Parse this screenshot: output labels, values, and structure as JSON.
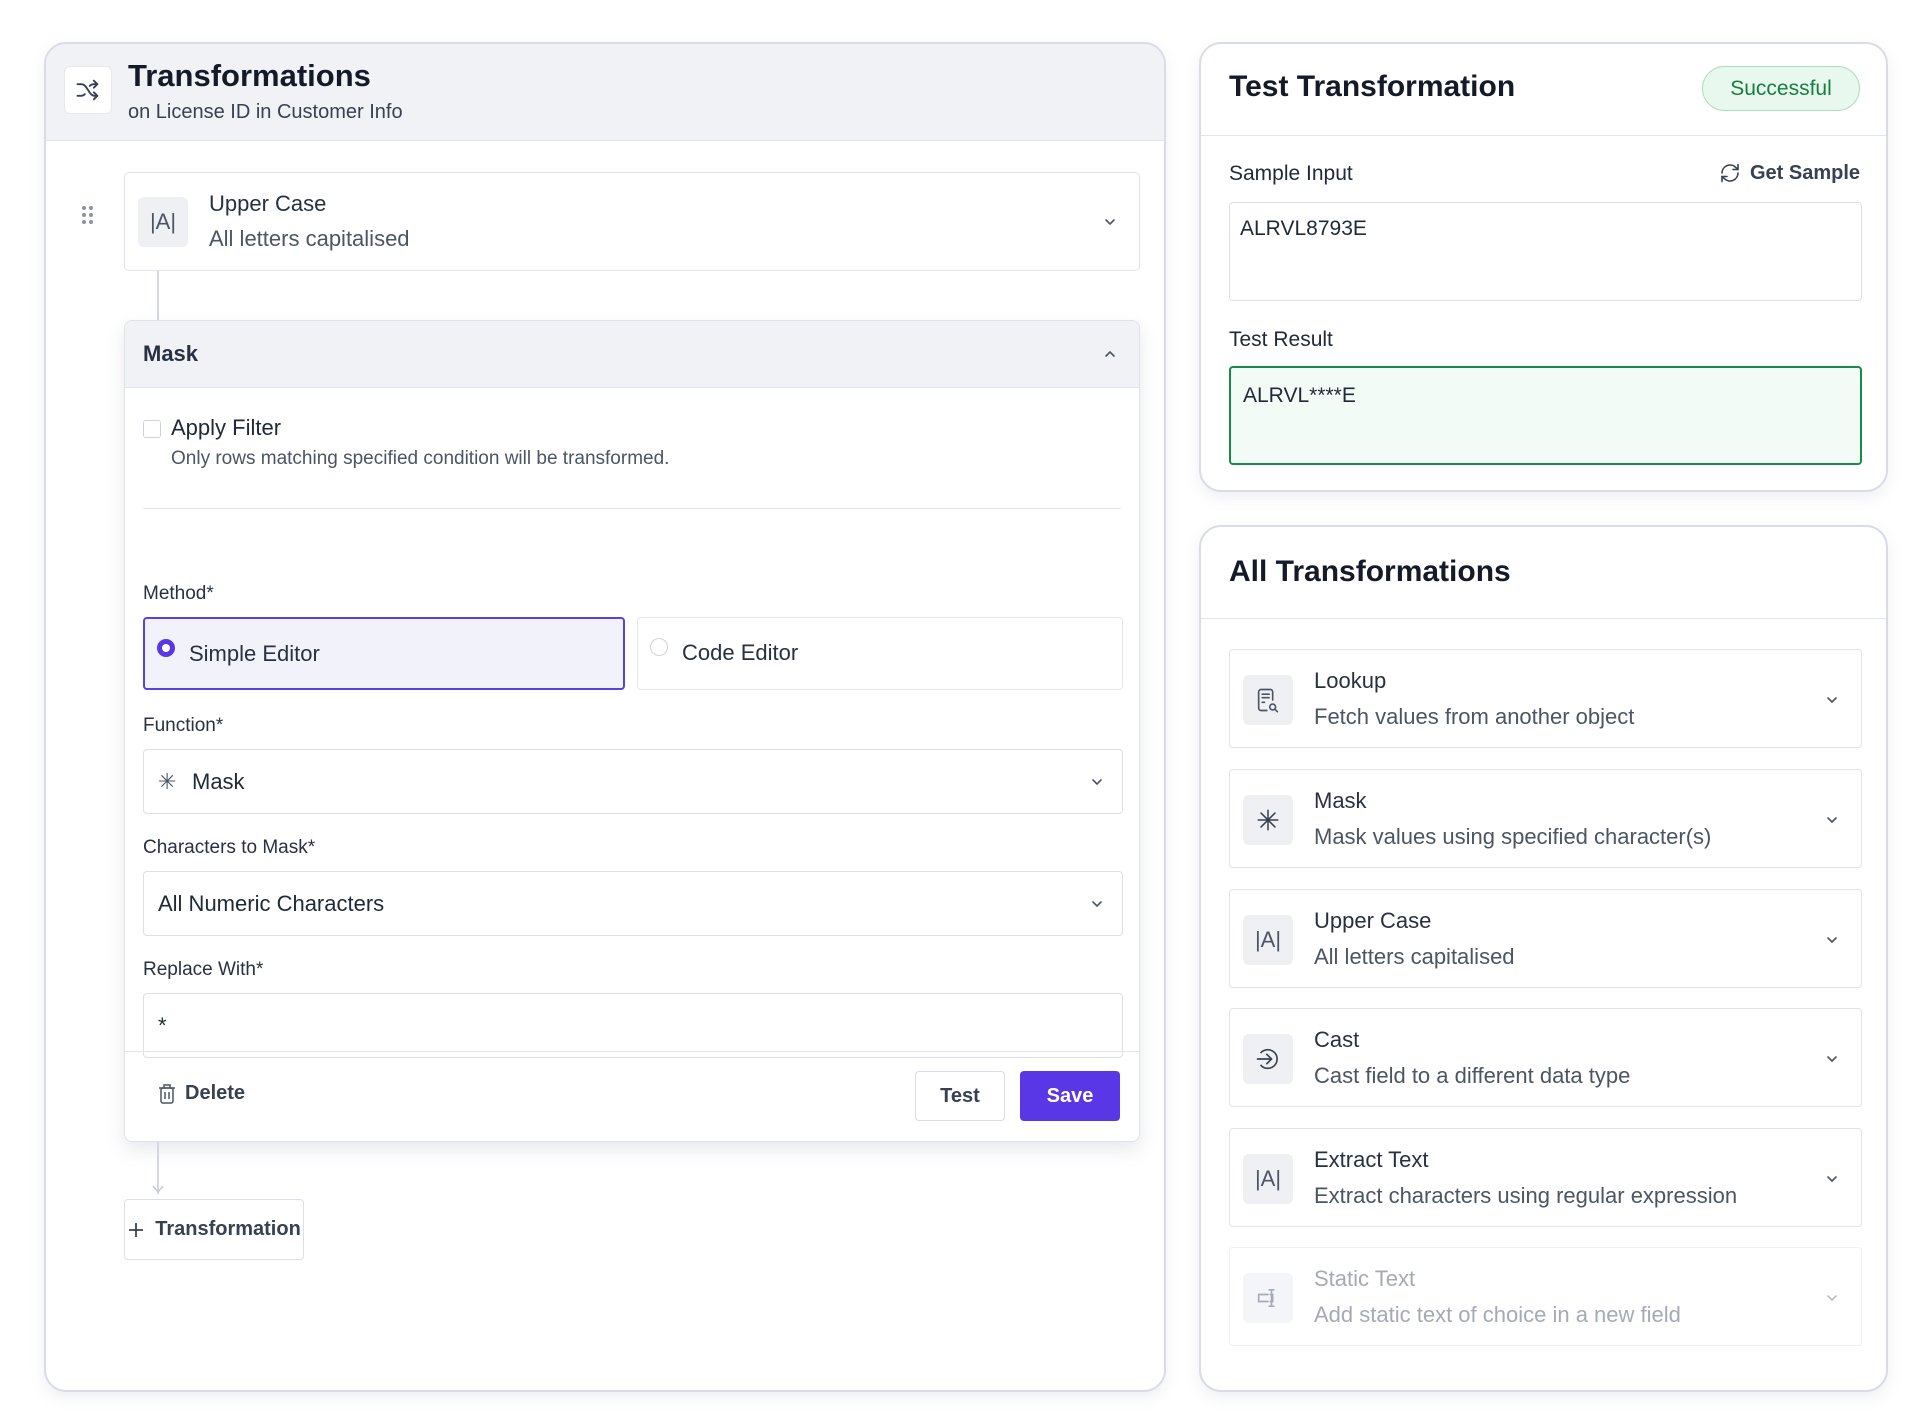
{
  "left_panel": {
    "title": "Transformations",
    "subtitle": "on License ID in Customer Info",
    "header_icon": "shuffle-icon",
    "applied_transformation": {
      "icon": "text-case-icon",
      "icon_text": "|A|",
      "title": "Upper Case",
      "description": "All letters capitalised"
    },
    "mask_editor": {
      "title": "Mask",
      "apply_filter": {
        "label": "Apply Filter",
        "help": "Only rows matching specified condition will be transformed.",
        "checked": false
      },
      "method": {
        "label": "Method*",
        "options": [
          {
            "label": "Simple Editor",
            "selected": true
          },
          {
            "label": "Code Editor",
            "selected": false
          }
        ]
      },
      "function": {
        "label": "Function*",
        "icon_glyph": "✳",
        "value": "Mask"
      },
      "characters_to_mask": {
        "label": "Characters to Mask*",
        "value": "All Numeric Characters"
      },
      "replace_with": {
        "label": "Replace With*",
        "value": "*"
      },
      "footer": {
        "delete_label": "Delete",
        "test_label": "Test",
        "save_label": "Save"
      }
    },
    "add_transformation_label": "Transformation"
  },
  "test_panel": {
    "title": "Test Transformation",
    "status": "Successful",
    "sample_input_label": "Sample Input",
    "get_sample_label": "Get Sample",
    "sample_input_value": "ALRVL8793E",
    "test_result_label": "Test Result",
    "test_result_value": "ALRVL****E"
  },
  "all_panel": {
    "title": "All Transformations",
    "items": [
      {
        "icon": "lookup-icon",
        "title": "Lookup",
        "description": "Fetch values from another object",
        "disabled": false
      },
      {
        "icon": "asterisk-icon",
        "title": "Mask",
        "description": "Mask values using specified character(s)",
        "disabled": false
      },
      {
        "icon": "text-case-icon",
        "icon_text": "|A|",
        "title": "Upper Case",
        "description": "All letters capitalised",
        "disabled": false
      },
      {
        "icon": "cast-icon",
        "title": "Cast",
        "description": "Cast field to a different data type",
        "disabled": false
      },
      {
        "icon": "text-case-icon",
        "icon_text": "|A|",
        "title": "Extract Text",
        "description": "Extract characters using regular expression",
        "disabled": false
      },
      {
        "icon": "static-text-icon",
        "title": "Static Text",
        "description": "Add static text of choice in a new field",
        "disabled": true
      }
    ]
  },
  "colors": {
    "accent": "#5a37e6",
    "success": "#15803d",
    "success_border": "#1a8a4c",
    "success_bg": "#f3fbf6"
  }
}
